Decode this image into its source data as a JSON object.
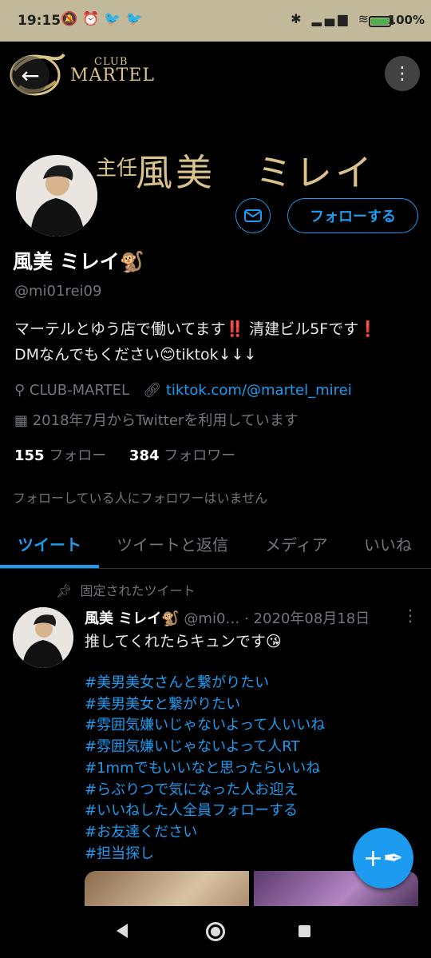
{
  "status_bar": {
    "time": "19:15",
    "left_icons": [
      "notifications-off-icon",
      "alarm-icon",
      "twitter-icon",
      "twitter-icon"
    ],
    "battery_percent": "100%"
  },
  "banner": {
    "logo_club": "CLUB",
    "logo_name": "MARTEL",
    "title": "風美　ミレイ",
    "subtitle": "主任"
  },
  "profile": {
    "message_icon": "mail-icon",
    "follow_label": "フォローする",
    "name": "風美 ミレイ🐒",
    "handle": "@mi01rei09",
    "bio_line1": "マーテルとゆう店で働いてます",
    "bio_line1_emoji": "‼️",
    "bio_line1_rest": " 清建ビル5Fです",
    "bio_line1_emoji2": "❗",
    "bio_line2": "DMなんでもください😊tiktok↓↓↓",
    "location": "CLUB-MARTEL",
    "link": "tiktok.com/@martel_mirei",
    "joined": "2018年7月からTwitterを利用しています",
    "following_count": "155",
    "following_label": "フォロー",
    "followers_count": "384",
    "followers_label": "フォロワー",
    "no_mutual_followers": "フォローしている人にフォロワーはいません"
  },
  "tabs": [
    {
      "label": "ツイート",
      "active": true
    },
    {
      "label": "ツイートと返信",
      "active": false
    },
    {
      "label": "メディア",
      "active": false
    },
    {
      "label": "いいね",
      "active": false
    }
  ],
  "tweet": {
    "pinned_label": "固定されたツイート",
    "author_name": "風美 ミレイ🐒",
    "author_handle": "@mi0…",
    "date": "· 2020年08月18日",
    "text": "推してくれたらキュンです😘",
    "hashtags": [
      "#美男美女さんと繋がりたい",
      "#美男美女と繋がりたい",
      "#雰囲気嫌いじゃないよって人いいね",
      "#雰囲気嫌いじゃないよって人RT",
      "#1mmでもいいなと思ったらいいね",
      "#らぶりつで気になった人お迎え",
      "#いいねした人全員フォローする",
      "#お友達ください",
      "#担当探し"
    ]
  },
  "fab_icon": "compose-tweet-icon",
  "colors": {
    "accent": "#1d9bf0",
    "background": "#000000",
    "muted_text": "#71767b",
    "gold": "#d9c38b"
  }
}
